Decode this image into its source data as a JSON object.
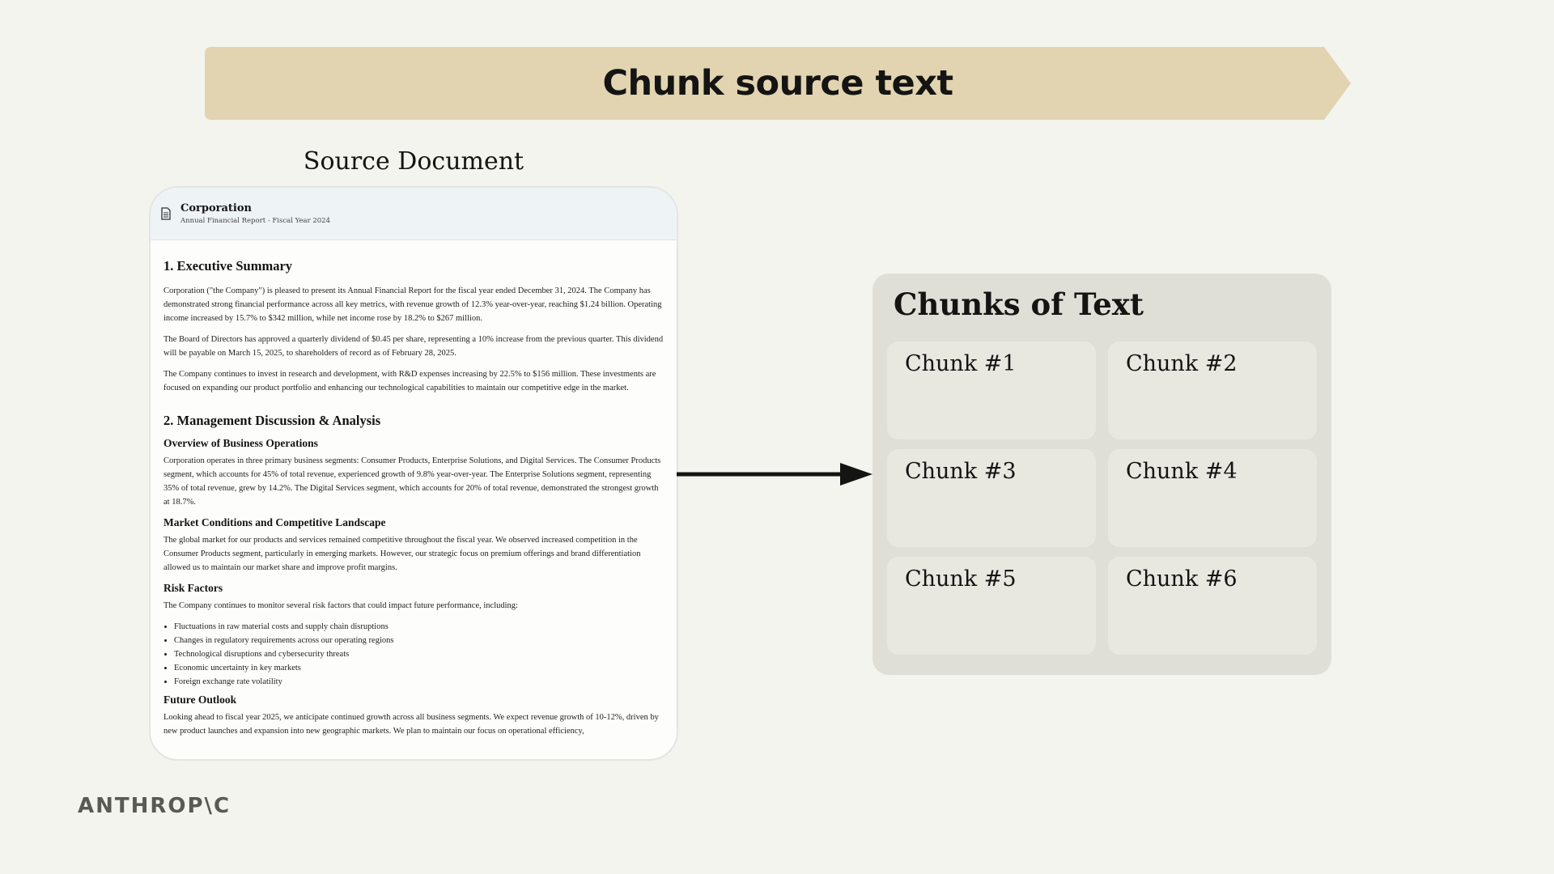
{
  "banner": {
    "title": "Chunk source text",
    "color": "#e2d4b0"
  },
  "source": {
    "label": "Source Document",
    "company": "Corporation",
    "subtitle": "Annual Financial Report - Fiscal Year 2024",
    "icon": "document-icon",
    "section1": {
      "heading": "1. Executive Summary",
      "p1": "Corporation (\"the Company\") is pleased to present its Annual Financial Report for the fiscal year ended December 31, 2024. The Company has demonstrated strong financial performance across all key metrics, with revenue growth of 12.3% year-over-year, reaching $1.24 billion. Operating income increased by 15.7% to $342 million, while net income rose by 18.2% to $267 million.",
      "p2": "The Board of Directors has approved a quarterly dividend of $0.45 per share, representing a 10% increase from the previous quarter. This dividend will be payable on March 15, 2025, to shareholders of record as of February 28, 2025.",
      "p3": "The Company continues to invest in research and development, with R&D expenses increasing by 22.5% to $156 million. These investments are focused on expanding our product portfolio and enhancing our technological capabilities to maintain our competitive edge in the market."
    },
    "section2": {
      "heading": "2. Management Discussion & Analysis",
      "sub1": "Overview of Business Operations",
      "p1": "Corporation operates in three primary business segments: Consumer Products, Enterprise Solutions, and Digital Services. The Consumer Products segment, which accounts for 45% of total revenue, experienced growth of 9.8% year-over-year. The Enterprise Solutions segment, representing 35% of total revenue, grew by 14.2%. The Digital Services segment, which accounts for 20% of total revenue, demonstrated the strongest growth at 18.7%.",
      "sub2": "Market Conditions and Competitive Landscape",
      "p2": "The global market for our products and services remained competitive throughout the fiscal year. We observed increased competition in the Consumer Products segment, particularly in emerging markets. However, our strategic focus on premium offerings and brand differentiation allowed us to maintain our market share and improve profit margins.",
      "sub3": "Risk Factors",
      "p3": "The Company continues to monitor several risk factors that could impact future performance, including:",
      "risks": [
        "Fluctuations in raw material costs and supply chain disruptions",
        "Changes in regulatory requirements across our operating regions",
        "Technological disruptions and cybersecurity threats",
        "Economic uncertainty in key markets",
        "Foreign exchange rate volatility"
      ],
      "sub4": "Future Outlook",
      "p4": "Looking ahead to fiscal year 2025, we anticipate continued growth across all business segments. We expect revenue growth of 10-12%, driven by new product launches and expansion into new geographic markets. We plan to maintain our focus on operational efficiency,"
    }
  },
  "chunks": {
    "title": "Chunks of Text",
    "items": [
      "Chunk #1",
      "Chunk #2",
      "Chunk #3",
      "Chunk #4",
      "Chunk #5",
      "Chunk #6"
    ]
  },
  "logo": "ANTHROP\\C"
}
